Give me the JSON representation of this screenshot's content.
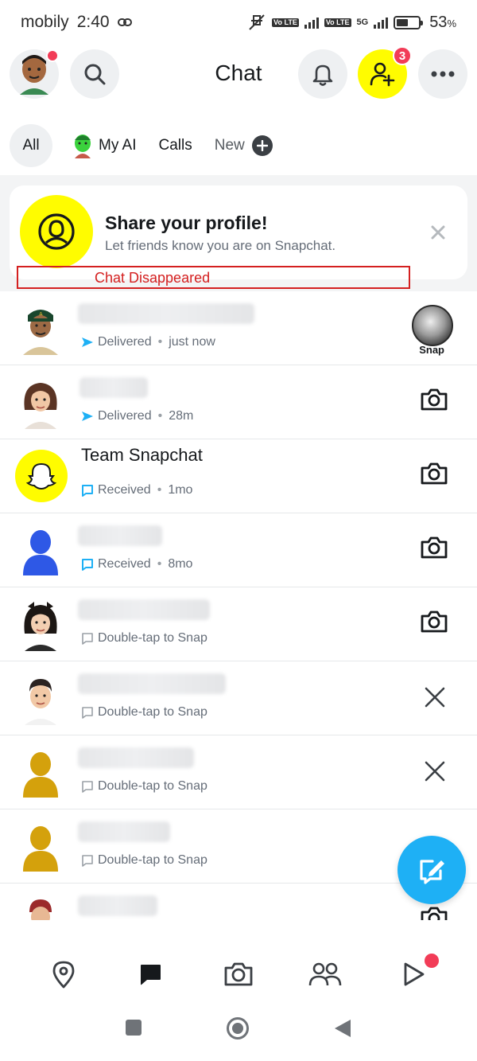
{
  "status_bar": {
    "carrier": "mobily",
    "time": "2:40",
    "battery": "53",
    "battery_unit": "%",
    "network": "5G",
    "volte": "Vo LTE"
  },
  "header": {
    "title": "Chat",
    "add_friends_badge": "3"
  },
  "tabs": [
    {
      "label": "All"
    },
    {
      "label": "My AI"
    },
    {
      "label": "Calls"
    },
    {
      "label": "New"
    }
  ],
  "profile_card": {
    "title": "Share your profile!",
    "subtitle": "Let friends know you are on Snapchat."
  },
  "annotation": {
    "label": "Chat Disappeared"
  },
  "chats": [
    {
      "name": "",
      "status": "Delivered",
      "time": "just now",
      "status_type": "delivered",
      "action": "snap-thumbnail",
      "action_label": "Snap"
    },
    {
      "name": "",
      "status": "Delivered",
      "time": "28m",
      "status_type": "delivered",
      "action": "camera"
    },
    {
      "name": "Team Snapchat",
      "status": "Received",
      "time": "1mo",
      "status_type": "received",
      "action": "camera"
    },
    {
      "name": "",
      "status": "Received",
      "time": "8mo",
      "status_type": "received",
      "action": "camera"
    },
    {
      "name": "",
      "status": "Double-tap to Snap",
      "time": "",
      "status_type": "idle",
      "action": "camera"
    },
    {
      "name": "",
      "status": "Double-tap to Snap",
      "time": "",
      "status_type": "idle",
      "action": "dismiss"
    },
    {
      "name": "",
      "status": "Double-tap to Snap",
      "time": "",
      "status_type": "idle",
      "action": "dismiss"
    },
    {
      "name": "",
      "status": "Double-tap to Snap",
      "time": "",
      "status_type": "idle",
      "action": "none"
    }
  ],
  "colors": {
    "brand_yellow": "#fffc00",
    "accent_blue": "#1eb0f5",
    "badge_red": "#f23c57",
    "annotation_red": "#d42020"
  },
  "icons": {
    "header": [
      "avatar",
      "search-icon",
      "bell-icon",
      "add-friend-icon",
      "more-icon"
    ],
    "bottom_nav": [
      "map-icon",
      "chat-icon",
      "camera-icon",
      "friends-icon",
      "stories-icon"
    ]
  }
}
